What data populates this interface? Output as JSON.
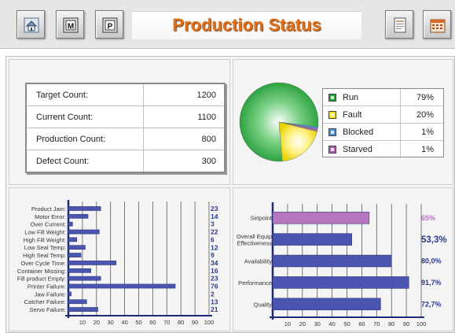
{
  "header": {
    "title": "Production Status",
    "buttons": [
      {
        "name": "home-button",
        "icon": "home-icon",
        "letter": ""
      },
      {
        "name": "m-button",
        "icon": "m-icon",
        "letter": "M"
      },
      {
        "name": "p-button",
        "icon": "p-icon",
        "letter": "P"
      },
      {
        "name": "report-button",
        "icon": "report-icon",
        "letter": ""
      },
      {
        "name": "calendar-button",
        "icon": "calendar-icon",
        "letter": ""
      }
    ]
  },
  "counts": [
    {
      "label": "Target Count:",
      "value": "1200"
    },
    {
      "label": "Current Count:",
      "value": "1100"
    },
    {
      "label": "Production Count:",
      "value": "800"
    },
    {
      "label": "Defect Count:",
      "value": "300"
    }
  ],
  "colors": {
    "title": "#e0721c",
    "run": "#22a33a",
    "fault": "#f2e21a",
    "blocked": "#4a8fcf",
    "starved": "#b45fb6",
    "bar": "#4a55b0",
    "setpoint": "#b576bf",
    "value_text": "#2a3a8c"
  },
  "chart_data": [
    {
      "type": "pie",
      "labels": [
        "Run",
        "Fault",
        "Blocked",
        "Starved"
      ],
      "values": [
        79,
        20,
        1,
        1
      ],
      "display_values": [
        "79%",
        "20%",
        "1%",
        "1%"
      ]
    },
    {
      "type": "bar",
      "orientation": "horizontal",
      "categories": [
        "Product Jam:",
        "Motor Error:",
        "Over Current:",
        "Low Fill Weight:",
        "High Fill Weight:",
        "Low Seal Temp:",
        "High Seal Temp:",
        "Over Cycle Time:",
        "Container Missing:",
        "Fill product Empty:",
        "Printer Failure:",
        "Jaw Failure:",
        "Catcher Failure:",
        "Servo Failure:"
      ],
      "values": [
        23,
        14,
        3,
        22,
        6,
        12,
        9,
        34,
        16,
        23,
        76,
        2,
        13,
        21
      ],
      "display_values": [
        "23",
        "14",
        "3",
        "22",
        "6",
        "12",
        "9",
        "34",
        "16",
        "23",
        "76",
        "2",
        "13",
        "21"
      ],
      "ticks": [
        "10",
        "20",
        "30",
        "40",
        "50",
        "60",
        "70",
        "80",
        "90",
        "100"
      ],
      "xlim": [
        0,
        100
      ]
    },
    {
      "type": "bar",
      "orientation": "horizontal",
      "categories": [
        "Setpoint",
        "Overall Equip Effectiveness",
        "Availability",
        "Performance",
        "Quality"
      ],
      "category_lines": [
        [
          "Setpoint"
        ],
        [
          "Overall Equip",
          "Effectiveness"
        ],
        [
          "Availability"
        ],
        [
          "Performance"
        ],
        [
          "Quality"
        ]
      ],
      "values": [
        65,
        53.3,
        80,
        91.7,
        72.7
      ],
      "display_values": [
        "65%",
        "53,3%",
        "80,0%",
        "91,7%",
        "72,7%"
      ],
      "ticks": [
        "10",
        "20",
        "30",
        "40",
        "50",
        "60",
        "70",
        "80",
        "90",
        "100"
      ],
      "xlim": [
        0,
        100
      ]
    }
  ]
}
